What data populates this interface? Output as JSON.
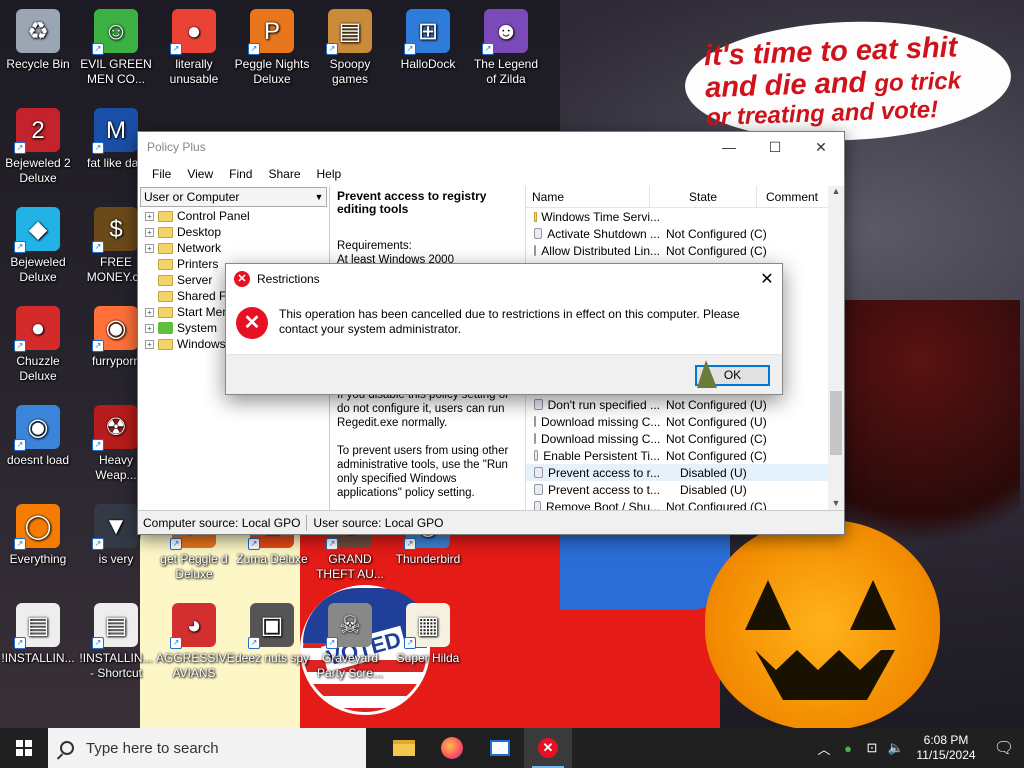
{
  "wallpaper": {
    "speech_bubble_line1": "it's time to eat shit",
    "speech_bubble_line2a": "and die and",
    "speech_bubble_line2b": "go trick",
    "speech_bubble_line3": "or treating and vote!",
    "badge_text": "VOTED"
  },
  "desktop_icons": [
    {
      "label": "Recycle Bin",
      "icon": "recycle-bin-icon"
    },
    {
      "label": "EVIL GREEN MEN CO...",
      "icon": "green-men-icon"
    },
    {
      "label": "literally unusable",
      "icon": "chrome-icon"
    },
    {
      "label": "Peggle Nights Deluxe",
      "icon": "peggle-icon"
    },
    {
      "label": "Spoopy games",
      "icon": "folder-icon"
    },
    {
      "label": "HalloDock",
      "icon": "windows-logo-icon"
    },
    {
      "label": "The Legend of Zilda",
      "icon": "zilda-icon"
    },
    {
      "label": "Bejeweled 2 Deluxe",
      "icon": "bejeweled2-icon"
    },
    {
      "label": "fat like darl",
      "icon": "mpl-icon"
    },
    {
      "label": "Bejeweled Deluxe",
      "icon": "gem-icon"
    },
    {
      "label": "FREE MONEY.co",
      "icon": "money-bag-icon"
    },
    {
      "label": "Chuzzle Deluxe",
      "icon": "chuzzle-icon"
    },
    {
      "label": "furryporn",
      "icon": "firefox-icon"
    },
    {
      "label": "doesnt load",
      "icon": "thunderbird-icon"
    },
    {
      "label": "Heavy Weap...",
      "icon": "radiation-icon"
    },
    {
      "label": "Everything",
      "icon": "search-ring-icon"
    },
    {
      "label": "is very",
      "icon": "shield-icon"
    },
    {
      "label": "get Peggle d Deluxe",
      "icon": "peggle-icon"
    },
    {
      "label": "Zuma Deluxe",
      "icon": "zuma-icon"
    },
    {
      "label": "GRAND THEFT AU...",
      "icon": "gta-icon"
    },
    {
      "label": "Thunderbird",
      "icon": "thunderbird-icon"
    },
    {
      "label": "!INSTALLIN...",
      "icon": "document-icon"
    },
    {
      "label": "!INSTALLIN... - Shortcut",
      "icon": "document-icon"
    },
    {
      "label": "AGGRESSIVE AVIANS",
      "icon": "angry-bird-icon"
    },
    {
      "label": "deez nuts spy",
      "icon": "windows-stack-icon"
    },
    {
      "label": "Graveyard Party Scre...",
      "icon": "graveyard-icon"
    },
    {
      "label": "Super Hilda",
      "icon": "pixel-dog-icon"
    }
  ],
  "window": {
    "title": "Policy Plus",
    "menu": [
      "File",
      "View",
      "Find",
      "Share",
      "Help"
    ],
    "combo_value": "User or Computer",
    "tree": [
      "Control Panel",
      "Desktop",
      "Network",
      "Printers",
      "Server",
      "Shared F",
      "Start Men",
      "System",
      "Windows"
    ],
    "desc_title": "Prevent access to registry editing tools",
    "desc_requirements_label": "Requirements:",
    "desc_requirements_value": "At least Windows 2000",
    "desc_para1": "If you disable this policy setting or do not configure it, users can run Regedit.exe normally.",
    "desc_para2": "To prevent users from using other administrative tools, use the \"Run only specified Windows applications\" policy setting.",
    "columns": {
      "name": "Name",
      "state": "State",
      "comment": "Comment"
    },
    "rows_top": [
      {
        "name": "Windows Time Servi...",
        "state": "",
        "folder": true
      },
      {
        "name": "Activate Shutdown ...",
        "state": "Not Configured (C)"
      },
      {
        "name": "Allow Distributed Lin...",
        "state": "Not Configured (C)"
      }
    ],
    "rows_bottom": [
      {
        "name": "Don't run specified ...",
        "state": "Not Configured (U)"
      },
      {
        "name": "Download missing C...",
        "state": "Not Configured (U)"
      },
      {
        "name": "Download missing C...",
        "state": "Not Configured (C)"
      },
      {
        "name": "Enable Persistent Ti...",
        "state": "Not Configured (C)"
      },
      {
        "name": "Prevent access to r...",
        "state": "Disabled (U)"
      },
      {
        "name": "Prevent access to t...",
        "state": "Disabled (U)"
      },
      {
        "name": "Remove Boot / Shu...",
        "state": "Not Configured (C)"
      }
    ],
    "status_computer_label": "Computer source:",
    "status_computer_value": "Local GPO",
    "status_user_label": "User source:",
    "status_user_value": "Local GPO"
  },
  "dialog": {
    "title": "Restrictions",
    "message": "This operation has been cancelled due to restrictions in effect on this computer. Please contact your system administrator.",
    "ok_label": "OK"
  },
  "taskbar": {
    "search_placeholder": "Type here to search",
    "time": "6:08 PM",
    "date": "11/15/2024"
  },
  "colors": {
    "error_red": "#e81123",
    "accent_blue": "#0078d7",
    "taskbar_bg": "#202020"
  }
}
